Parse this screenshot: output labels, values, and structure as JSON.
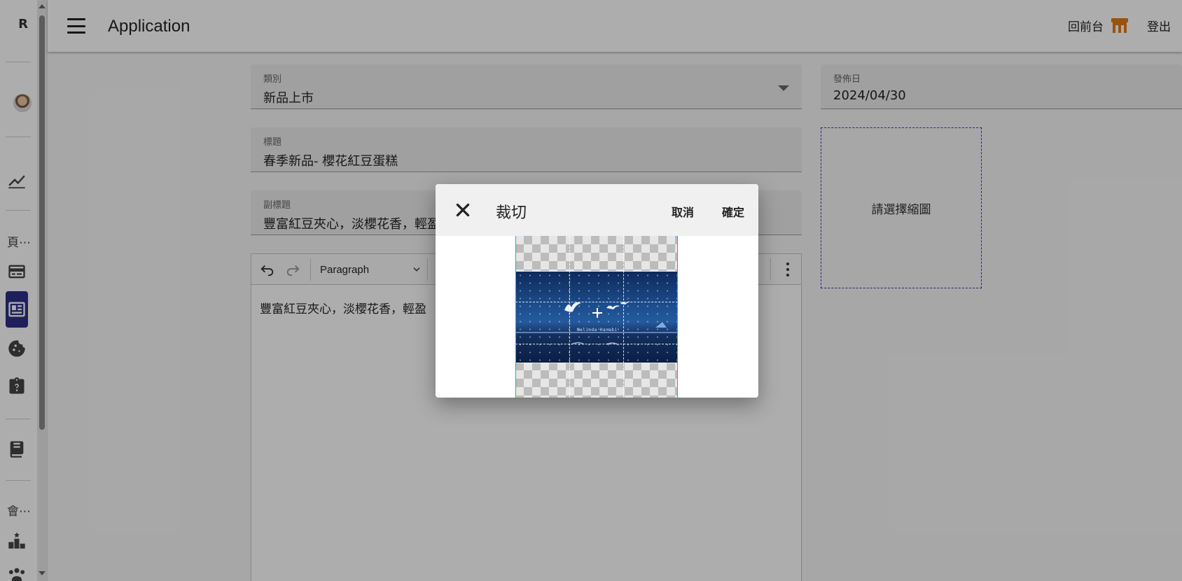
{
  "appbar": {
    "title": "Application",
    "back_to_front": "回前台",
    "logout": "登出"
  },
  "rail": {
    "logo": "R",
    "section_pages": "頁⋯",
    "section_members": "會⋯",
    "active_item": "news-icon"
  },
  "form": {
    "category": {
      "label": "類別",
      "value": "新品上市"
    },
    "publish_date": {
      "label": "發佈日",
      "value": "2024/04/30"
    },
    "title": {
      "label": "標題",
      "value": "春季新品- 櫻花紅豆蛋糕"
    },
    "subtitle": {
      "label": "副標題",
      "value": "豐富紅豆夾心，淡櫻花香，輕盈"
    },
    "thumbnail_prompt": "請選擇縮圖"
  },
  "editor": {
    "block_format": "Paragraph",
    "content": "豐富紅豆夾心，淡櫻花香，輕盈"
  },
  "crop_dialog": {
    "title": "裁切",
    "cancel": "取消",
    "confirm": "確定",
    "image_caption": "Nelinda Hanabi"
  },
  "colors": {
    "accent": "#2e2e8a",
    "store_icon": "#e07b17",
    "thumb_border": "#3a3aa8"
  }
}
